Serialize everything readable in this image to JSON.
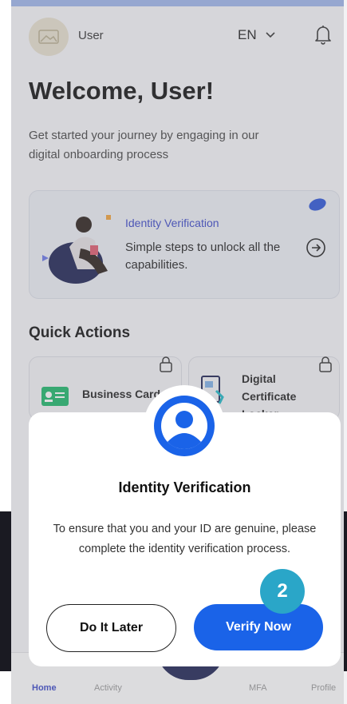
{
  "header": {
    "username": "User",
    "language": "EN",
    "avatar_icon": "avatar-icon",
    "bell_icon": "bell-icon"
  },
  "welcome": {
    "title": "Welcome, User!",
    "subtitle": "Get started your journey by engaging in our digital onboarding process"
  },
  "identity_card": {
    "title": "Identity Verification",
    "description": "Simple steps to unlock all the capabilities."
  },
  "quick_actions": {
    "title": "Quick Actions",
    "items": [
      {
        "label": "Business Card"
      },
      {
        "label": "Digital Certificate Locker"
      }
    ]
  },
  "bottom_nav": {
    "items": [
      {
        "label": "Home"
      },
      {
        "label": "Activity"
      },
      {
        "label": "MFA"
      },
      {
        "label": "Profile"
      }
    ]
  },
  "modal": {
    "title": "Identity Verification",
    "message": "To ensure that you and your ID are genuine, please complete the identity verification process.",
    "later_label": "Do It Later",
    "verify_label": "Verify Now",
    "step_badge": "2"
  },
  "colors": {
    "accent": "#1a63e8",
    "step_badge": "#2aa6c8",
    "link": "#3a47c8"
  }
}
